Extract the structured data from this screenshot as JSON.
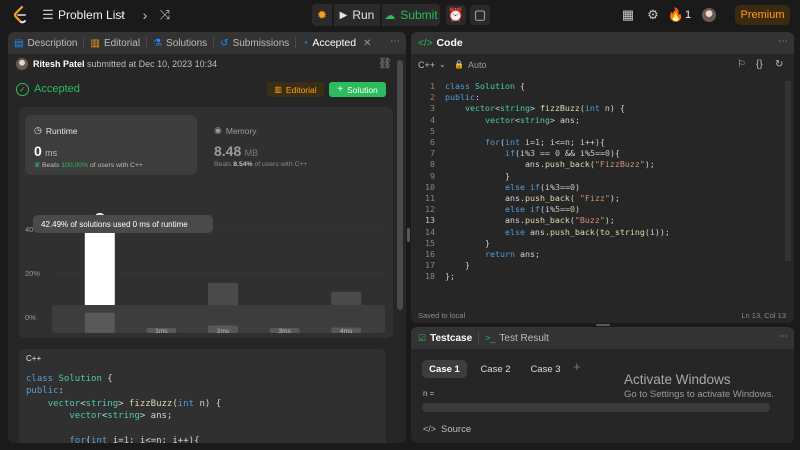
{
  "topbar": {
    "problem_list": "Problem List",
    "run": "Run",
    "submit": "Submit",
    "streak": "1",
    "premium": "Premium"
  },
  "left_panel": {
    "tabs": [
      {
        "label": "Description",
        "icon": "description-icon"
      },
      {
        "label": "Editorial",
        "icon": "book-icon"
      },
      {
        "label": "Solutions",
        "icon": "flask-icon"
      },
      {
        "label": "Submissions",
        "icon": "history-icon"
      },
      {
        "label": "Accepted",
        "icon": "clock-icon"
      }
    ],
    "submitted_by": "Ritesh Patel",
    "submitted_text": "submitted at Dec 10, 2023 10:34",
    "status": "Accepted",
    "editorial_btn": "Editorial",
    "solution_btn": "Solution",
    "runtime": {
      "label": "Runtime",
      "value": "0",
      "unit": "ms",
      "beats_prefix": "Beats",
      "beats_pct": "100.00%",
      "beats_suffix": "of users with C++"
    },
    "memory": {
      "label": "Memory",
      "value": "8.48",
      "unit": "MB",
      "beats_prefix": "Beats",
      "beats_pct": "8.54%",
      "beats_suffix": "of users with C++"
    },
    "tooltip": "42.49% of solutions used 0 ms of runtime",
    "lang_label": "C++",
    "code_preview": [
      "class Solution {",
      "public:",
      "    vector<string> fizzBuzz(int n) {",
      "        vector<string> ans;",
      "",
      "        for(int i=1; i<=n; i++){"
    ]
  },
  "chart_data": {
    "type": "bar",
    "categories": [
      "0ms",
      "1ms",
      "2ms",
      "3ms",
      "4ms"
    ],
    "x_labels": [
      "",
      "1ms",
      "2ms",
      "3ms",
      "4ms"
    ],
    "values": [
      42.49,
      2,
      15.5,
      2,
      11.5
    ],
    "y_ticks": [
      "0%",
      "20%",
      "40%"
    ],
    "ylim": [
      0,
      50
    ],
    "grid": true,
    "highlight_index": 0,
    "mini_values": [
      42.49,
      2,
      15.5,
      2,
      11.5
    ],
    "mini_labels": [
      "",
      "1ms",
      "2ms",
      "3ms",
      "4ms"
    ]
  },
  "right_panel": {
    "code_tab": "Code",
    "lang": "C++",
    "auto": "Auto",
    "saved": "Saved to local",
    "cursor": "Ln 13, Col 13",
    "code_lines": [
      "class Solution {",
      "public:",
      "    vector<string> fizzBuzz(int n) {",
      "        vector<string> ans;",
      "",
      "        for(int i=1; i<=n; i++){",
      "            if(i%3 == 0 && i%5==0){",
      "                ans.push_back(\"FizzBuzz\");",
      "            }",
      "            else if(i%3==0)",
      "            ans.push_back( \"Fizz\");",
      "            else if(i%5==0)",
      "            ans.push_back(\"Buzz\");",
      "            else ans.push_back(to_string(i));",
      "        }",
      "        return ans;",
      "    }",
      "};"
    ],
    "testcase_tab": "Testcase",
    "result_tab": "Test Result",
    "cases": [
      "Case 1",
      "Case 2",
      "Case 3"
    ],
    "n_label": "n =",
    "source": "Source"
  },
  "watermark": {
    "title": "Activate Windows",
    "subtitle": "Go to Settings to activate Windows."
  },
  "colors": {
    "accent": "#2cbb5d",
    "brand": "#ffa116",
    "bg": "#1a1a1a",
    "panel": "#262626"
  }
}
